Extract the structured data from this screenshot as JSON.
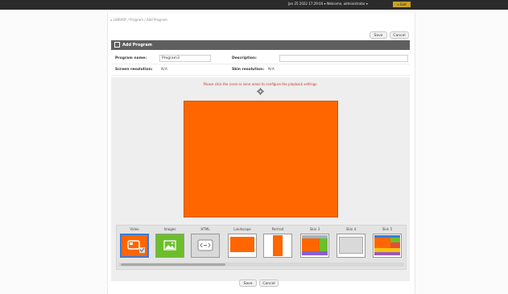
{
  "topbar": {
    "status": "Jan 25 2022 17:29:04 ▾  Welcome, administrator ▾",
    "logout_label": "» Exit"
  },
  "breadcrumb": "⌂ LIBRARY / Program / Add Program",
  "actions": {
    "save_label": "Save",
    "cancel_label": "Cancel"
  },
  "panel": {
    "title": "Add Program"
  },
  "form": {
    "program_name_label": "Program name:",
    "program_name_value": "Program3",
    "description_label": "Description:",
    "description_value": "",
    "screen_resolution_label": "Screen resolution:",
    "screen_resolution_value": "N/A",
    "skin_resolution_label": "Skin resolution:",
    "skin_resolution_value": "N/A"
  },
  "hint": "Please click the icons or zone areas to configure the playback settings.",
  "colors": {
    "canvas": "#ff6600",
    "images_green": "#6cbf2a",
    "header": "#5f5f5f"
  },
  "templates": [
    {
      "label": "Video",
      "icon": "film-icon"
    },
    {
      "label": "Images",
      "icon": "image-icon"
    },
    {
      "label": "HTML",
      "icon": "html-icon"
    },
    {
      "label": "Landscape",
      "icon": "landscape-layout"
    },
    {
      "label": "Portrait",
      "icon": "portrait-layout"
    },
    {
      "label": "Skin 3",
      "icon": "skin-3-layout"
    },
    {
      "label": "Skin 4",
      "icon": "skin-4-layout"
    },
    {
      "label": "Skin 5",
      "icon": "skin-5-layout"
    }
  ]
}
